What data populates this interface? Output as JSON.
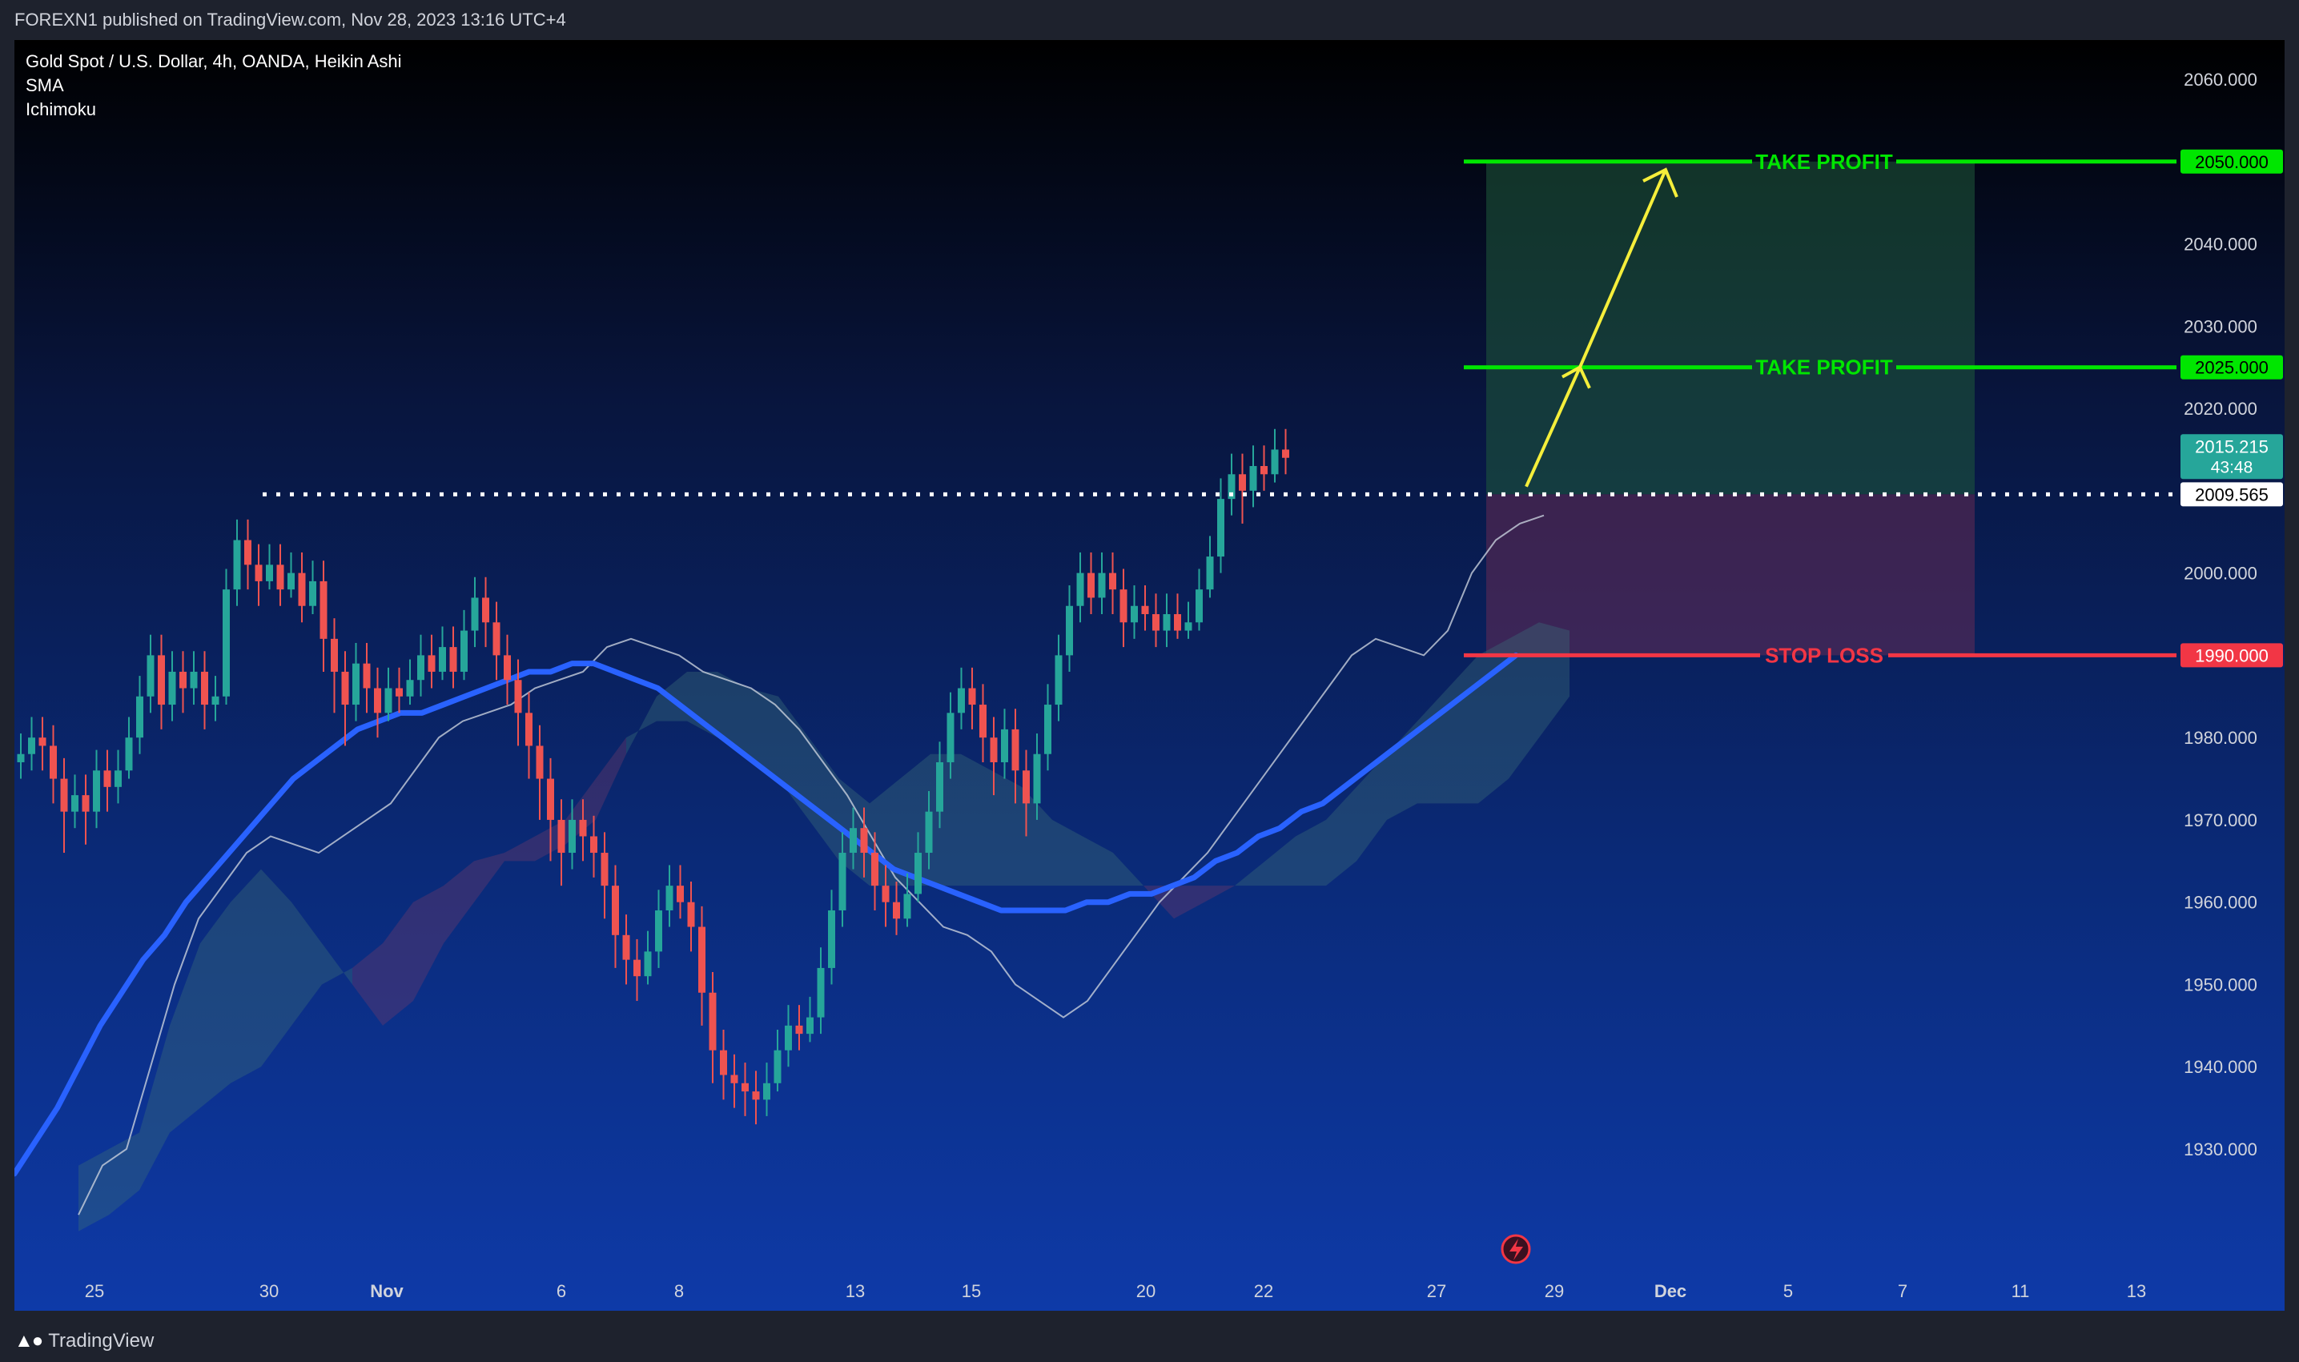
{
  "header": {
    "publish_note": "FOREXN1 published on TradingView.com, Nov 28, 2023 13:16 UTC+4"
  },
  "footer": {
    "brand": "TradingView"
  },
  "legend": {
    "symbol_line": "Gold Spot / U.S. Dollar, 4h, OANDA, Heikin Ashi",
    "indicator_1": "SMA",
    "indicator_2": "Ichimoku"
  },
  "colors": {
    "bull": "#26a69a",
    "bear": "#ef5350",
    "sma": "#2962ff",
    "take_profit": "#00e600",
    "stop_loss": "#f23645",
    "arrow": "#f5ee3b",
    "cloud_bull": "#3a6b78",
    "cloud_bear": "#6b3a6b"
  },
  "chart_data": {
    "type": "candlestick",
    "title": "Gold Spot / U.S. Dollar, 4h, OANDA, Heikin Ashi",
    "ylim": [
      1920,
      2065
    ],
    "y_ticks": [
      2060,
      2050,
      2040,
      2030,
      2020,
      2010,
      2000,
      1990,
      1980,
      1970,
      1960,
      1950,
      1940,
      1930
    ],
    "y_tick_labels": [
      "2060.000",
      "2040.000",
      "2030.000",
      "2020.000",
      "2000.000",
      "1980.000",
      "1970.000",
      "1960.000",
      "1950.000",
      "1940.000",
      "1930.000"
    ],
    "x_tick_labels": [
      "25",
      "30",
      "Nov",
      "6",
      "8",
      "13",
      "15",
      "20",
      "22",
      "27",
      "29",
      "Dec",
      "5",
      "7",
      "11",
      "13"
    ],
    "current_price": {
      "label": "2015.215",
      "countdown": "43:48",
      "value": 2015.215
    },
    "level_marker": {
      "label": "2009.565",
      "value": 2009.565
    },
    "take_profit_levels": [
      {
        "label": "TAKE PROFIT",
        "value": 2050,
        "price_label": "2050.000"
      },
      {
        "label": "TAKE PROFIT",
        "value": 2025,
        "price_label": "2025.000"
      }
    ],
    "stop_loss": {
      "label": "STOP LOSS",
      "value": 1990,
      "price_label": "1990.000"
    },
    "candles": [
      [
        1977,
        1978,
        1975
      ],
      [
        1978,
        1980,
        1976
      ],
      [
        1980,
        1979,
        1976
      ],
      [
        1979,
        1975,
        1972
      ],
      [
        1975,
        1971,
        1966
      ],
      [
        1971,
        1973,
        1969
      ],
      [
        1973,
        1971,
        1967
      ],
      [
        1971,
        1976,
        1969
      ],
      [
        1976,
        1974,
        1971
      ],
      [
        1974,
        1976,
        1972
      ],
      [
        1976,
        1980,
        1975
      ],
      [
        1980,
        1985,
        1978
      ],
      [
        1985,
        1990,
        1983
      ],
      [
        1990,
        1984,
        1981
      ],
      [
        1984,
        1988,
        1982
      ],
      [
        1988,
        1986,
        1983
      ],
      [
        1986,
        1988,
        1984
      ],
      [
        1988,
        1984,
        1981
      ],
      [
        1984,
        1985,
        1982
      ],
      [
        1985,
        1998,
        1984
      ],
      [
        1998,
        2004,
        1996
      ],
      [
        2004,
        2001,
        1998
      ],
      [
        2001,
        1999,
        1996
      ],
      [
        1999,
        2001,
        1998
      ],
      [
        2001,
        1998,
        1996
      ],
      [
        1998,
        2000,
        1997
      ],
      [
        2000,
        1996,
        1994
      ],
      [
        1996,
        1999,
        1995
      ],
      [
        1999,
        1992,
        1988
      ],
      [
        1992,
        1988,
        1983
      ],
      [
        1988,
        1984,
        1979
      ],
      [
        1984,
        1989,
        1982
      ],
      [
        1989,
        1986,
        1983
      ],
      [
        1986,
        1983,
        1980
      ],
      [
        1983,
        1986,
        1982
      ],
      [
        1986,
        1985,
        1983
      ],
      [
        1985,
        1987,
        1984
      ],
      [
        1987,
        1990,
        1985
      ],
      [
        1990,
        1988,
        1986
      ],
      [
        1988,
        1991,
        1987
      ],
      [
        1991,
        1988,
        1986
      ],
      [
        1988,
        1993,
        1987
      ],
      [
        1993,
        1997,
        1991
      ],
      [
        1997,
        1994,
        1991
      ],
      [
        1994,
        1990,
        1987
      ],
      [
        1990,
        1987,
        1984
      ],
      [
        1987,
        1983,
        1979
      ],
      [
        1983,
        1979,
        1975
      ],
      [
        1979,
        1975,
        1970
      ],
      [
        1975,
        1970,
        1965
      ],
      [
        1970,
        1966,
        1962
      ],
      [
        1966,
        1970,
        1964
      ],
      [
        1970,
        1968,
        1965
      ],
      [
        1968,
        1966,
        1963
      ],
      [
        1966,
        1962,
        1958
      ],
      [
        1962,
        1956,
        1952
      ],
      [
        1956,
        1953,
        1950
      ],
      [
        1953,
        1951,
        1948
      ],
      [
        1951,
        1954,
        1950
      ],
      [
        1954,
        1959,
        1952
      ],
      [
        1959,
        1962,
        1957
      ],
      [
        1962,
        1960,
        1958
      ],
      [
        1960,
        1957,
        1954
      ],
      [
        1957,
        1949,
        1945
      ],
      [
        1949,
        1942,
        1938
      ],
      [
        1942,
        1939,
        1936
      ],
      [
        1939,
        1938,
        1935
      ],
      [
        1938,
        1937,
        1934
      ],
      [
        1937,
        1936,
        1933
      ],
      [
        1936,
        1938,
        1934
      ],
      [
        1938,
        1942,
        1937
      ],
      [
        1942,
        1945,
        1940
      ],
      [
        1945,
        1944,
        1942
      ],
      [
        1944,
        1946,
        1943
      ],
      [
        1946,
        1952,
        1944
      ],
      [
        1952,
        1959,
        1950
      ],
      [
        1959,
        1966,
        1957
      ],
      [
        1966,
        1969,
        1964
      ],
      [
        1969,
        1966,
        1963
      ],
      [
        1966,
        1962,
        1959
      ],
      [
        1962,
        1960,
        1957
      ],
      [
        1960,
        1958,
        1956
      ],
      [
        1958,
        1961,
        1957
      ],
      [
        1961,
        1966,
        1960
      ],
      [
        1966,
        1971,
        1964
      ],
      [
        1971,
        1977,
        1969
      ],
      [
        1977,
        1983,
        1975
      ],
      [
        1983,
        1986,
        1981
      ],
      [
        1986,
        1984,
        1981
      ],
      [
        1984,
        1980,
        1977
      ],
      [
        1980,
        1977,
        1973
      ],
      [
        1977,
        1981,
        1975
      ],
      [
        1981,
        1976,
        1972
      ],
      [
        1976,
        1972,
        1968
      ],
      [
        1972,
        1978,
        1970
      ],
      [
        1978,
        1984,
        1976
      ],
      [
        1984,
        1990,
        1982
      ],
      [
        1990,
        1996,
        1988
      ],
      [
        1996,
        2000,
        1994
      ],
      [
        2000,
        1997,
        1995
      ],
      [
        1997,
        2000,
        1995
      ],
      [
        2000,
        1998,
        1995
      ],
      [
        1998,
        1994,
        1991
      ],
      [
        1994,
        1996,
        1992
      ],
      [
        1996,
        1995,
        1993
      ],
      [
        1995,
        1993,
        1991
      ],
      [
        1993,
        1995,
        1991
      ],
      [
        1995,
        1993,
        1992
      ],
      [
        1993,
        1994,
        1992
      ],
      [
        1994,
        1998,
        1993
      ],
      [
        1998,
        2002,
        1997
      ],
      [
        2002,
        2009,
        2000
      ],
      [
        2009,
        2012,
        2007
      ],
      [
        2012,
        2010,
        2006
      ],
      [
        2010,
        2013,
        2008
      ],
      [
        2013,
        2012,
        2010
      ],
      [
        2012,
        2015,
        2011
      ],
      [
        2015,
        2014,
        2012
      ]
    ],
    "sma": [
      1927,
      1931,
      1935,
      1940,
      1945,
      1949,
      1953,
      1956,
      1960,
      1963,
      1966,
      1969,
      1972,
      1975,
      1977,
      1979,
      1981,
      1982,
      1983,
      1983,
      1984,
      1985,
      1986,
      1987,
      1988,
      1988,
      1989,
      1989,
      1988,
      1987,
      1986,
      1984,
      1982,
      1980,
      1978,
      1976,
      1974,
      1972,
      1970,
      1968,
      1966,
      1964,
      1963,
      1962,
      1961,
      1960,
      1959,
      1959,
      1959,
      1959,
      1960,
      1960,
      1961,
      1961,
      1962,
      1963,
      1965,
      1966,
      1968,
      1969,
      1971,
      1972,
      1974,
      1976,
      1978,
      1980,
      1982,
      1984,
      1986,
      1988,
      1990
    ],
    "ichimoku_lagging": [
      1922,
      1928,
      1930,
      1940,
      1950,
      1958,
      1962,
      1966,
      1968,
      1967,
      1966,
      1968,
      1970,
      1972,
      1976,
      1980,
      1982,
      1983,
      1984,
      1986,
      1987,
      1988,
      1991,
      1992,
      1991,
      1990,
      1988,
      1987,
      1986,
      1984,
      1981,
      1977,
      1973,
      1968,
      1963,
      1960,
      1957,
      1956,
      1954,
      1950,
      1948,
      1946,
      1948,
      1952,
      1956,
      1960,
      1963,
      1966,
      1970,
      1974,
      1978,
      1982,
      1986,
      1990,
      1992,
      1991,
      1990,
      1993,
      2000,
      2004,
      2006,
      2007
    ],
    "ichimoku_span_a": [
      1928,
      1930,
      1932,
      1945,
      1955,
      1960,
      1964,
      1960,
      1955,
      1950,
      1945,
      1948,
      1955,
      1960,
      1965,
      1965,
      1967,
      1970,
      1978,
      1985,
      1988,
      1988,
      1986,
      1985,
      1980,
      1975,
      1972,
      1975,
      1978,
      1978,
      1976,
      1974,
      1970,
      1968,
      1966,
      1962,
      1958,
      1960,
      1962,
      1965,
      1968,
      1970,
      1974,
      1978,
      1982,
      1986,
      1990,
      1992,
      1994,
      1993
    ],
    "ichimoku_span_b": [
      1920,
      1922,
      1925,
      1932,
      1935,
      1938,
      1940,
      1945,
      1950,
      1952,
      1955,
      1960,
      1962,
      1965,
      1966,
      1968,
      1970,
      1975,
      1980,
      1982,
      1982,
      1980,
      1978,
      1975,
      1970,
      1965,
      1962,
      1962,
      1962,
      1962,
      1962,
      1962,
      1962,
      1962,
      1962,
      1962,
      1962,
      1962,
      1962,
      1962,
      1962,
      1962,
      1965,
      1970,
      1972,
      1972,
      1972,
      1975,
      1980,
      1985
    ]
  }
}
